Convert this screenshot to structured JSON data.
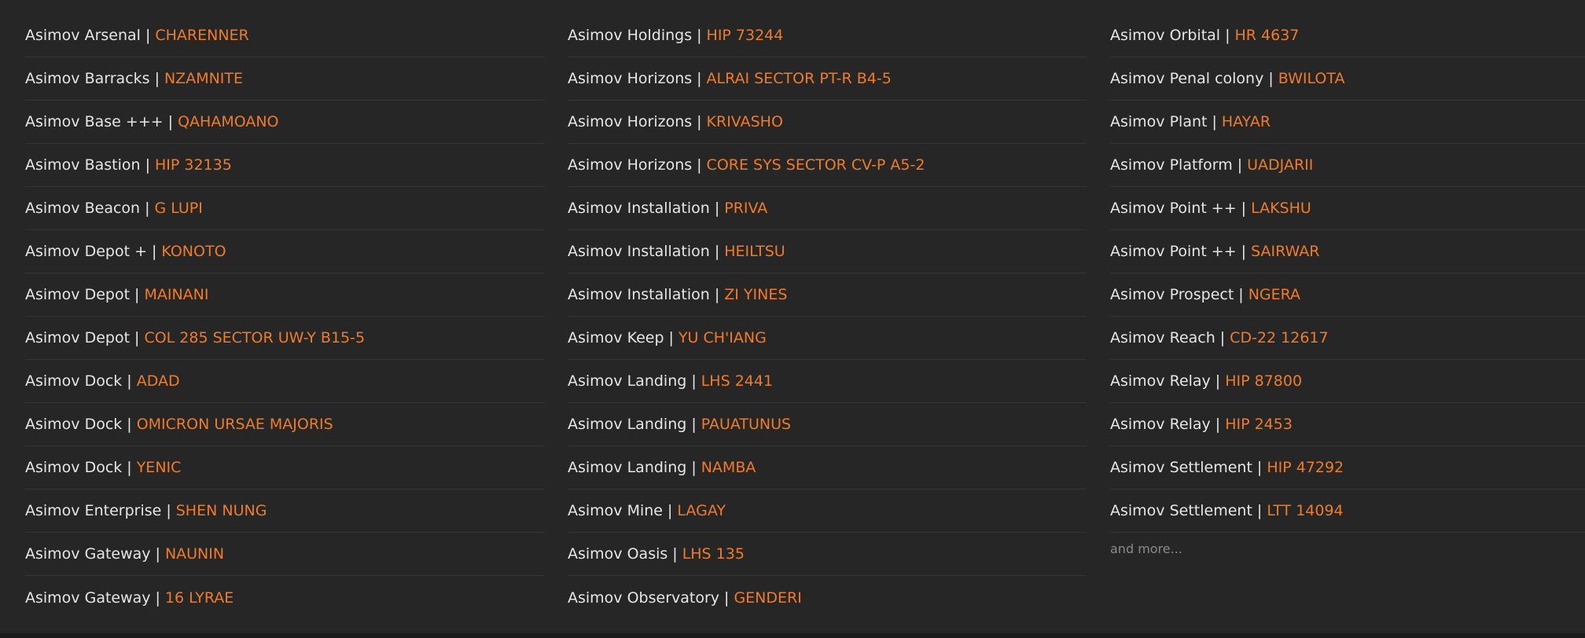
{
  "separator": "|",
  "more_label": "and more...",
  "columns": [
    [
      {
        "name": "Asimov Arsenal",
        "system": "CHARENNER"
      },
      {
        "name": "Asimov Barracks",
        "system": "NZAMNITE"
      },
      {
        "name": "Asimov Base +++",
        "system": "QAHAMOANO"
      },
      {
        "name": "Asimov Bastion",
        "system": "HIP 32135"
      },
      {
        "name": "Asimov Beacon",
        "system": "G LUPI"
      },
      {
        "name": "Asimov Depot +",
        "system": "KONOTO"
      },
      {
        "name": "Asimov Depot",
        "system": "MAINANI"
      },
      {
        "name": "Asimov Depot",
        "system": "COL 285 SECTOR UW-Y B15-5"
      },
      {
        "name": "Asimov Dock",
        "system": "ADAD"
      },
      {
        "name": "Asimov Dock",
        "system": "OMICRON URSAE MAJORIS"
      },
      {
        "name": "Asimov Dock",
        "system": "YENIC"
      },
      {
        "name": "Asimov Enterprise",
        "system": "SHEN NUNG"
      },
      {
        "name": "Asimov Gateway",
        "system": "NAUNIN"
      },
      {
        "name": "Asimov Gateway",
        "system": "16 LYRAE"
      }
    ],
    [
      {
        "name": "Asimov Holdings",
        "system": "HIP 73244"
      },
      {
        "name": "Asimov Horizons",
        "system": "ALRAI SECTOR PT-R B4-5"
      },
      {
        "name": "Asimov Horizons",
        "system": "KRIVASHO"
      },
      {
        "name": "Asimov Horizons",
        "system": "CORE SYS SECTOR CV-P A5-2"
      },
      {
        "name": "Asimov Installation",
        "system": "PRIVA"
      },
      {
        "name": "Asimov Installation",
        "system": "HEILTSU"
      },
      {
        "name": "Asimov Installation",
        "system": "ZI YINES"
      },
      {
        "name": "Asimov Keep",
        "system": "YU CH'IANG"
      },
      {
        "name": "Asimov Landing",
        "system": "LHS 2441"
      },
      {
        "name": "Asimov Landing",
        "system": "PAUATUNUS"
      },
      {
        "name": "Asimov Landing",
        "system": "NAMBA"
      },
      {
        "name": "Asimov Mine",
        "system": "LAGAY"
      },
      {
        "name": "Asimov Oasis",
        "system": "LHS 135"
      },
      {
        "name": "Asimov Observatory",
        "system": "GENDERI"
      }
    ],
    [
      {
        "name": "Asimov Orbital",
        "system": "HR 4637"
      },
      {
        "name": "Asimov Penal colony",
        "system": "BWILOTA"
      },
      {
        "name": "Asimov Plant",
        "system": "HAYAR"
      },
      {
        "name": "Asimov Platform",
        "system": "UADJARII"
      },
      {
        "name": "Asimov Point ++",
        "system": "LAKSHU"
      },
      {
        "name": "Asimov Point ++",
        "system": "SAIRWAR"
      },
      {
        "name": "Asimov Prospect",
        "system": "NGERA"
      },
      {
        "name": "Asimov Reach",
        "system": "CD-22 12617"
      },
      {
        "name": "Asimov Relay",
        "system": "HIP 87800"
      },
      {
        "name": "Asimov Relay",
        "system": "HIP 2453"
      },
      {
        "name": "Asimov Settlement",
        "system": "HIP 47292"
      },
      {
        "name": "Asimov Settlement",
        "system": "LTT 14094"
      }
    ]
  ],
  "colors": {
    "background": "#262626",
    "station_text": "#e6e6e6",
    "system_text": "#f07b28",
    "divider": "#353535",
    "more_text": "#8a8a8a"
  }
}
